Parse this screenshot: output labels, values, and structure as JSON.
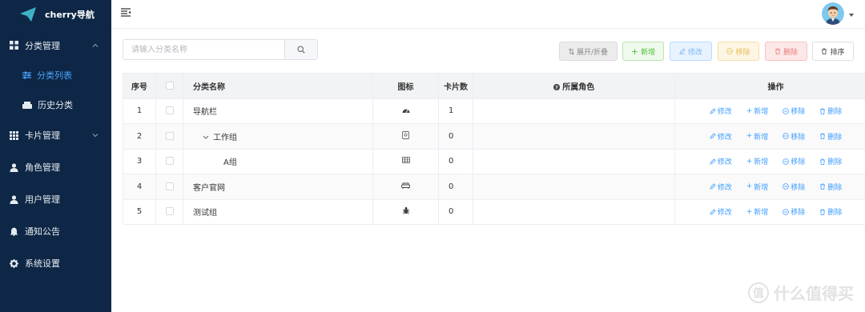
{
  "brand": {
    "name": "cherry导航"
  },
  "sidebar": {
    "groups": [
      {
        "label": "分类管理",
        "icon": "grid-icon",
        "expanded": true,
        "children": [
          {
            "label": "分类列表",
            "icon": "sliders-icon",
            "active": true
          },
          {
            "label": "历史分类",
            "icon": "history-icon",
            "active": false
          }
        ]
      },
      {
        "label": "卡片管理",
        "icon": "cards-icon",
        "expanded": false
      },
      {
        "label": "角色管理",
        "icon": "user-icon"
      },
      {
        "label": "用户管理",
        "icon": "user-icon"
      },
      {
        "label": "通知公告",
        "icon": "bell-icon"
      },
      {
        "label": "系统设置",
        "icon": "gear-icon"
      }
    ]
  },
  "search": {
    "placeholder": "请输入分类名称",
    "value": ""
  },
  "toolbar": {
    "toggle_label": "展开/折叠",
    "add_label": "新增",
    "edit_label": "修改",
    "move_label": "移除",
    "delete_label": "删除",
    "sort_label": "排序"
  },
  "table": {
    "headers": {
      "index": "序号",
      "name": "分类名称",
      "icon": "图标",
      "count": "卡片数",
      "roles": "所属角色",
      "ops": "操作"
    },
    "rows": [
      {
        "index": "1",
        "name": "导航栏",
        "icon": "dashboard-icon",
        "count": "1",
        "roles": "",
        "level": 0,
        "expandable": false
      },
      {
        "index": "2",
        "name": "工作组",
        "icon": "badge-icon",
        "count": "0",
        "roles": "",
        "level": 1,
        "expandable": true
      },
      {
        "index": "3",
        "name": "A组",
        "icon": "table-icon",
        "count": "0",
        "roles": "",
        "level": 2,
        "expandable": false
      },
      {
        "index": "4",
        "name": "客户官网",
        "icon": "sofa-icon",
        "count": "0",
        "roles": "",
        "level": 0,
        "expandable": false
      },
      {
        "index": "5",
        "name": "测试组",
        "icon": "bug-icon",
        "count": "0",
        "roles": "",
        "level": 0,
        "expandable": false
      }
    ],
    "row_actions": {
      "edit": "修改",
      "add": "新增",
      "move": "移除",
      "delete": "删除"
    }
  },
  "watermark": {
    "text": "什么值得买",
    "mark": "值"
  },
  "colors": {
    "sidebar_bg": "#0e2746",
    "active": "#4aa3ff",
    "link": "#409eff"
  }
}
